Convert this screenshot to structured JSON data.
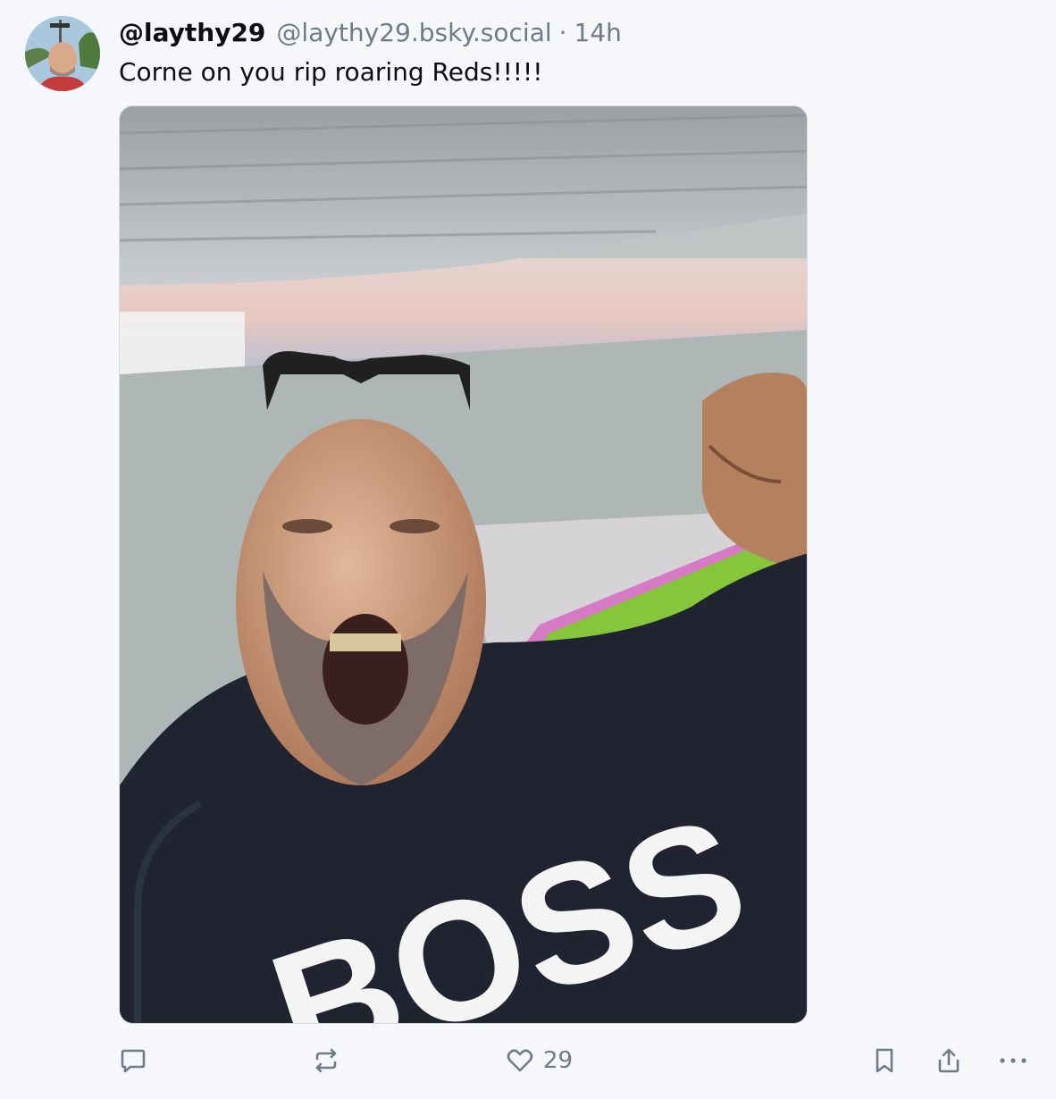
{
  "post": {
    "display_name": "@laythy29",
    "handle": "@laythy29.bsky.social",
    "separator": "·",
    "time": "14h",
    "text": "Corne on you rip roaring Reds!!!!!",
    "image_text": "BOSS"
  },
  "actions": {
    "reply_icon": "speech-bubble-icon",
    "repost_icon": "repost-arrows-icon",
    "like_icon": "heart-icon",
    "like_count": "29",
    "bookmark_icon": "bookmark-icon",
    "share_icon": "share-upload-icon",
    "more_icon": "ellipsis-icon"
  },
  "colors": {
    "background": "#f6f7fa",
    "text_primary": "#0b0f14",
    "text_secondary": "#6f7b89",
    "media_border": "#d6dbe2"
  }
}
